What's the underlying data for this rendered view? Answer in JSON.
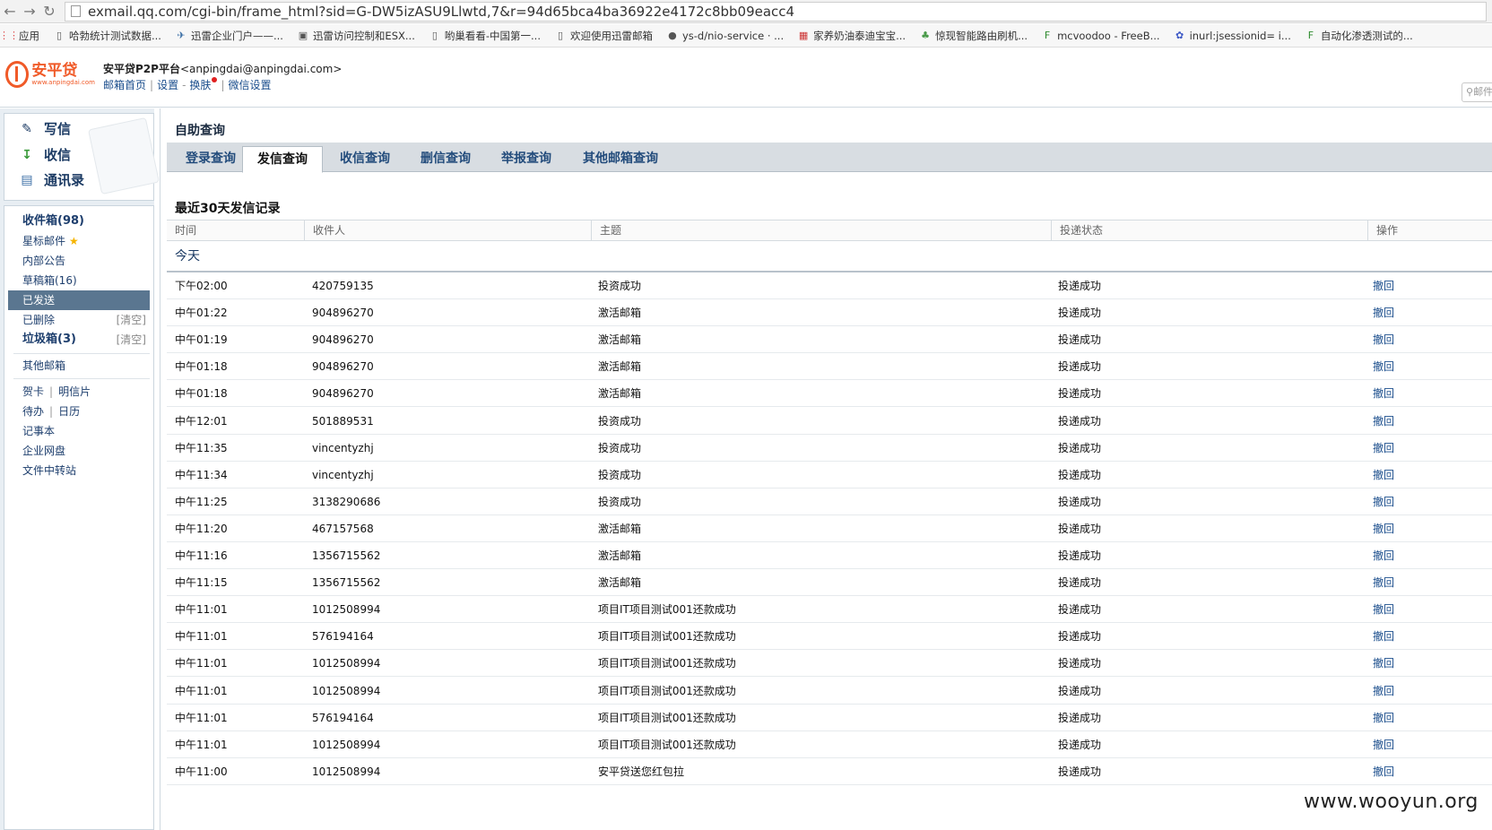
{
  "browser": {
    "url": "exmail.qq.com/cgi-bin/frame_html?sid=G-DW5izASU9Llwtd,7&r=94d65bca4ba36922e4172c8bb09eacc4",
    "bookmarks": [
      {
        "icon": "apps-icon",
        "label": "应用"
      },
      {
        "icon": "page-icon",
        "label": "哈勃统计测试数据..."
      },
      {
        "icon": "thunder-icon",
        "label": "迅雷企业门户——..."
      },
      {
        "icon": "terminal-icon",
        "label": "迅雷访问控制和ESX..."
      },
      {
        "icon": "page-icon",
        "label": "哟巢看看-中国第一..."
      },
      {
        "icon": "page-icon",
        "label": "欢迎使用迅雷邮箱"
      },
      {
        "icon": "github-icon",
        "label": "ys-d/nio-service · ..."
      },
      {
        "icon": "image-icon",
        "label": "家养奶油泰迪宝宝..."
      },
      {
        "icon": "leaf-icon",
        "label": "惊现智能路由刷机..."
      },
      {
        "icon": "f-icon",
        "label": "mcvoodoo - FreeB..."
      },
      {
        "icon": "paw-icon",
        "label": "inurl:jsessionid= i..."
      },
      {
        "icon": "f-icon",
        "label": "自动化渗透测试的..."
      }
    ]
  },
  "header": {
    "logo_cn": "安平贷",
    "logo_en": "www.anpingdai.com",
    "account_name": "安平贷P2P平台",
    "account_email": "<anpingdai@anpingdai.com>",
    "links": [
      "邮箱首页",
      "设置",
      "换肤",
      "微信设置"
    ],
    "search_placeholder": "邮件"
  },
  "sidebar": {
    "compose": [
      "写信",
      "收信",
      "通讯录"
    ],
    "folders": [
      {
        "label": "收件箱(98)",
        "extra": ""
      },
      {
        "label": "星标邮件",
        "extra": ""
      },
      {
        "label": "内部公告",
        "extra": ""
      },
      {
        "label": "草稿箱(16)",
        "extra": ""
      },
      {
        "label": "已发送",
        "extra": ""
      },
      {
        "label": "已删除",
        "extra": "[清空]"
      },
      {
        "label": "垃圾箱(3)",
        "extra": "[清空]"
      },
      {
        "label": "其他邮箱",
        "extra": ""
      }
    ],
    "tools": [
      {
        "a": "贺卡",
        "b": "明信片"
      },
      {
        "a": "待办",
        "b": "日历"
      },
      {
        "a": "记事本",
        "b": ""
      },
      {
        "a": "企业网盘",
        "b": ""
      },
      {
        "a": "文件中转站",
        "b": ""
      }
    ]
  },
  "main": {
    "title": "自助查询",
    "tabs": [
      "登录查询",
      "发信查询",
      "收信查询",
      "删信查询",
      "举报查询",
      "其他邮箱查询"
    ],
    "active_tab": 1,
    "section_title": "最近30天发信记录",
    "columns": [
      "时间",
      "收件人",
      "主题",
      "投递状态",
      "操作"
    ],
    "group": "今天",
    "rows": [
      {
        "time": "下午02:00",
        "to": "420759135",
        "subject": "投资成功",
        "status": "投递成功",
        "action": "撤回"
      },
      {
        "time": "中午01:22",
        "to": "904896270",
        "subject": "激活邮箱",
        "status": "投递成功",
        "action": "撤回"
      },
      {
        "time": "中午01:19",
        "to": "904896270",
        "subject": "激活邮箱",
        "status": "投递成功",
        "action": "撤回"
      },
      {
        "time": "中午01:18",
        "to": "904896270",
        "subject": "激活邮箱",
        "status": "投递成功",
        "action": "撤回"
      },
      {
        "time": "中午01:18",
        "to": "904896270",
        "subject": "激活邮箱",
        "status": "投递成功",
        "action": "撤回"
      },
      {
        "time": "中午12:01",
        "to": "501889531",
        "subject": "投资成功",
        "status": "投递成功",
        "action": "撤回"
      },
      {
        "time": "中午11:35",
        "to": "vincentyzhj",
        "subject": "投资成功",
        "status": "投递成功",
        "action": "撤回"
      },
      {
        "time": "中午11:34",
        "to": "vincentyzhj",
        "subject": "投资成功",
        "status": "投递成功",
        "action": "撤回"
      },
      {
        "time": "中午11:25",
        "to": "3138290686",
        "subject": "投资成功",
        "status": "投递成功",
        "action": "撤回"
      },
      {
        "time": "中午11:20",
        "to": "467157568",
        "subject": "激活邮箱",
        "status": "投递成功",
        "action": "撤回"
      },
      {
        "time": "中午11:16",
        "to": "1356715562",
        "subject": "激活邮箱",
        "status": "投递成功",
        "action": "撤回"
      },
      {
        "time": "中午11:15",
        "to": "1356715562",
        "subject": "激活邮箱",
        "status": "投递成功",
        "action": "撤回"
      },
      {
        "time": "中午11:01",
        "to": "1012508994",
        "subject": "项目IT项目测试001还款成功",
        "status": "投递成功",
        "action": "撤回"
      },
      {
        "time": "中午11:01",
        "to": "576194164",
        "subject": "项目IT项目测试001还款成功",
        "status": "投递成功",
        "action": "撤回"
      },
      {
        "time": "中午11:01",
        "to": "1012508994",
        "subject": "项目IT项目测试001还款成功",
        "status": "投递成功",
        "action": "撤回"
      },
      {
        "time": "中午11:01",
        "to": "1012508994",
        "subject": "项目IT项目测试001还款成功",
        "status": "投递成功",
        "action": "撤回"
      },
      {
        "time": "中午11:01",
        "to": "576194164",
        "subject": "项目IT项目测试001还款成功",
        "status": "投递成功",
        "action": "撤回"
      },
      {
        "time": "中午11:01",
        "to": "1012508994",
        "subject": "项目IT项目测试001还款成功",
        "status": "投递成功",
        "action": "撤回"
      },
      {
        "time": "中午11:00",
        "to": "1012508994",
        "subject": "安平贷送您红包拉",
        "status": "投递成功",
        "action": "撤回"
      }
    ]
  },
  "watermark": "www.wooyun.org"
}
